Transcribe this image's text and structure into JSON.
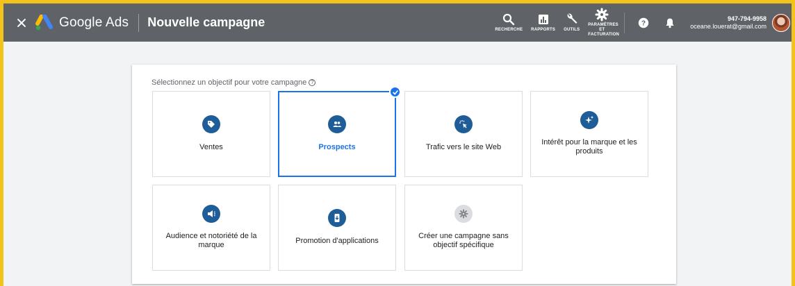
{
  "header": {
    "brand": "Google Ads",
    "title": "Nouvelle campagne",
    "tools": [
      {
        "label": "RECHERCHE",
        "icon": "search-icon"
      },
      {
        "label": "RAPPORTS",
        "icon": "reports-icon"
      },
      {
        "label": "OUTILS",
        "icon": "wrench-icon"
      },
      {
        "label": "PARAMÈTRES ET FACTURATION",
        "icon": "gear-icon"
      }
    ],
    "account": {
      "phone": "947-794-9958",
      "email": "oceane.louerat@gmail.com"
    }
  },
  "main": {
    "prompt": "Sélectionnez un objectif pour votre campagne",
    "objectives": [
      {
        "label": "Ventes",
        "icon": "tag-icon",
        "selected": false
      },
      {
        "label": "Prospects",
        "icon": "people-icon",
        "selected": true
      },
      {
        "label": "Trafic vers le site Web",
        "icon": "cursor-click-icon",
        "selected": false
      },
      {
        "label": "Intérêt pour la marque et les produits",
        "icon": "sparkle-icon",
        "selected": false
      },
      {
        "label": "Audience et notoriété de la marque",
        "icon": "megaphone-icon",
        "selected": false
      },
      {
        "label": "Promotion d'applications",
        "icon": "phone-download-icon",
        "selected": false
      },
      {
        "label": "Créer une campagne sans objectif spécifique",
        "icon": "gear-icon",
        "selected": false
      }
    ]
  },
  "colors": {
    "frame": "#f2c41b",
    "header_bg": "#5f6368",
    "accent": "#1a73e8",
    "icon_bg": "#1f5d99"
  }
}
